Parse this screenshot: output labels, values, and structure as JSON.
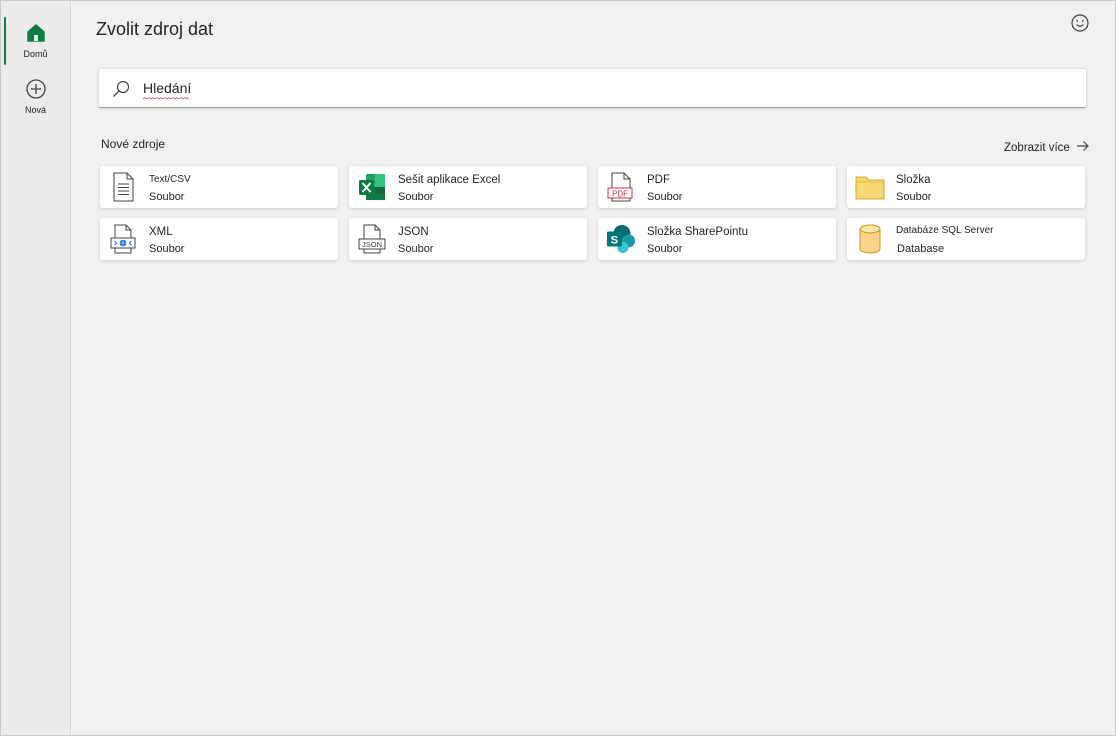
{
  "rail": {
    "items": [
      {
        "label": "Domů",
        "icon": "home-icon",
        "active": true
      },
      {
        "label": "Nová",
        "icon": "add-circle-icon",
        "active": false
      }
    ]
  },
  "header": {
    "title": "Zvolit zdroj dat"
  },
  "search": {
    "placeholder": "Hledání"
  },
  "sources": {
    "section_title": "Nové zdroje",
    "show_more": "Zobrazit více",
    "cards": [
      {
        "name": "Text/CSV",
        "type": "Soubor",
        "icon": "text-file-icon"
      },
      {
        "name": "Sešit aplikace Excel",
        "type": "Soubor",
        "icon": "excel-icon"
      },
      {
        "name": "PDF",
        "type": "Soubor",
        "icon": "pdf-icon"
      },
      {
        "name": "Složka",
        "type": "Soubor",
        "icon": "folder-icon"
      },
      {
        "name": "XML",
        "type": "Soubor",
        "icon": "xml-icon"
      },
      {
        "name": "JSON",
        "type": "Soubor",
        "icon": "json-icon"
      },
      {
        "name": "Složka SharePointu",
        "type": "Soubor",
        "icon": "sharepoint-icon"
      },
      {
        "name": "Databáze SQL Server",
        "type": "Database",
        "icon": "database-icon"
      }
    ]
  },
  "colors": {
    "accent": "#107c41",
    "folder": "#f8d775",
    "database": "#fbd38d",
    "sharepoint": "#038387"
  }
}
